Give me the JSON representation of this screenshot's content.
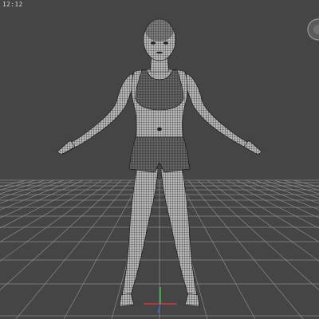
{
  "viewport": {
    "label": "12:12",
    "background_color": "#454545",
    "grid_color": "#8a8a8a",
    "wireframe_color": "#111111",
    "mesh_fill_color": "#b9b9b9"
  },
  "axes": {
    "x_color": "#d23a3a",
    "y_color": "#39c24a",
    "z_color": "#3a63d2"
  },
  "nav_gizmo": {
    "icon": "navigation-gizmo-icon"
  },
  "model": {
    "icon": "human-base-mesh-wireframe"
  }
}
